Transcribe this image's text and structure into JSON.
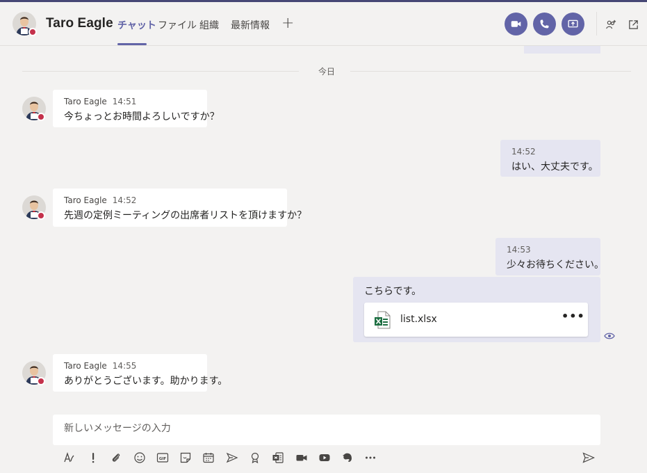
{
  "header": {
    "title": "Taro Eagle",
    "tabs": [
      "チャット",
      "ファイル",
      "組織",
      "最新情報"
    ],
    "add_tab": "+"
  },
  "day_divider": "今日",
  "messages": [
    {
      "author": "Taro Eagle",
      "time": "14:51",
      "text": "今ちょっとお時間よろしいですか？"
    },
    {
      "time": "14:52",
      "text": "はい、大丈夫です。"
    },
    {
      "author": "Taro Eagle",
      "time": "14:52",
      "text": "先週の定例ミーティングの出席者リストを頂けますか？"
    },
    {
      "time": "14:53",
      "text": "少々お待ちください。"
    },
    {
      "text": "こちらです。",
      "attachment": {
        "name": "list.xlsx",
        "more": "•••"
      }
    },
    {
      "author": "Taro Eagle",
      "time": "14:55",
      "text": "ありがとうございます。助かります。"
    }
  ],
  "compose": {
    "placeholder": "新しいメッセージの入力"
  },
  "colors": {
    "accent": "#6264a7",
    "presence_busy": "#c4314b",
    "own_message": "#e5e5f1",
    "background": "#f3f2f1",
    "excel_green": "#1d6f42"
  }
}
